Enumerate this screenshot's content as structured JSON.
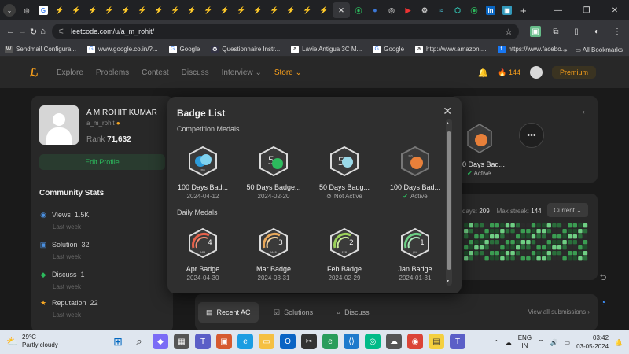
{
  "browser": {
    "url": "leetcode.com/u/a_m_rohit/",
    "bookmarks": [
      "Sendmail Configura...",
      "www.google.co.in/?...",
      "Google",
      "Questionnaire Instr...",
      "Lavie Antigua 3C M...",
      "Google",
      "http://www.amazon....",
      "https://www.facebo..."
    ],
    "all_bookmarks": "All Bookmarks"
  },
  "nav": {
    "items": [
      "Explore",
      "Problems",
      "Contest",
      "Discuss",
      "Interview",
      "Store"
    ],
    "streak": "144",
    "premium": "Premium"
  },
  "profile": {
    "name": "A M ROHIT KUMAR",
    "username": "a_m_rohit",
    "rank_label": "Rank",
    "rank_value": "71,632",
    "edit": "Edit Profile"
  },
  "community": {
    "title": "Community Stats",
    "stats": [
      {
        "label": "Views",
        "value": "1.5K",
        "sub": "Last week",
        "icon": "eye-icon",
        "color": "#4a90e2"
      },
      {
        "label": "Solution",
        "value": "32",
        "sub": "Last week",
        "icon": "solution-icon",
        "color": "#4a90e2"
      },
      {
        "label": "Discuss",
        "value": "1",
        "sub": "Last week",
        "icon": "discuss-icon",
        "color": "#2cbb5d"
      },
      {
        "label": "Reputation",
        "value": "22",
        "sub": "Last week",
        "icon": "star-icon",
        "color": "#f5a623"
      }
    ]
  },
  "right": {
    "badge_peek": "0 Days Bad...",
    "badge_active": "Active",
    "days_label": "days:",
    "days_value": "209",
    "max_streak_label": "Max streak:",
    "max_streak_value": "144",
    "current": "Current"
  },
  "bottom": {
    "tabs": [
      "Recent AC",
      "Solutions",
      "Discuss"
    ],
    "view_all": "View all submissions"
  },
  "modal": {
    "title": "Badge List",
    "competition_title": "Competition Medals",
    "daily_title": "Daily Medals",
    "competition": [
      {
        "name": "100 Days Bad...",
        "date": "2024-04-12",
        "status": ""
      },
      {
        "name": "50 Days Badge...",
        "date": "2024-02-20",
        "status": ""
      },
      {
        "name": "50 Days Badg...",
        "date": "",
        "status": "Not Active"
      },
      {
        "name": "100 Days Bad...",
        "date": "",
        "status": "Active"
      }
    ],
    "daily": [
      {
        "name": "Apr Badge",
        "date": "2024-04-30",
        "month": "APR",
        "num": "4",
        "color": "#e8614a"
      },
      {
        "name": "Mar Badge",
        "date": "2024-03-31",
        "month": "MAR",
        "num": "3",
        "color": "#e8a85a"
      },
      {
        "name": "Feb Badge",
        "date": "2024-02-29",
        "month": "FEB",
        "num": "2",
        "color": "#9bd25a"
      },
      {
        "name": "Jan Badge",
        "date": "2024-01-31",
        "month": "JAN",
        "num": "1",
        "color": "#6bcf84"
      }
    ]
  },
  "taskbar": {
    "temp": "29°C",
    "weather": "Partly cloudy",
    "lang1": "ENG",
    "lang2": "IN",
    "time": "03:42",
    "date": "03-05-2024"
  }
}
